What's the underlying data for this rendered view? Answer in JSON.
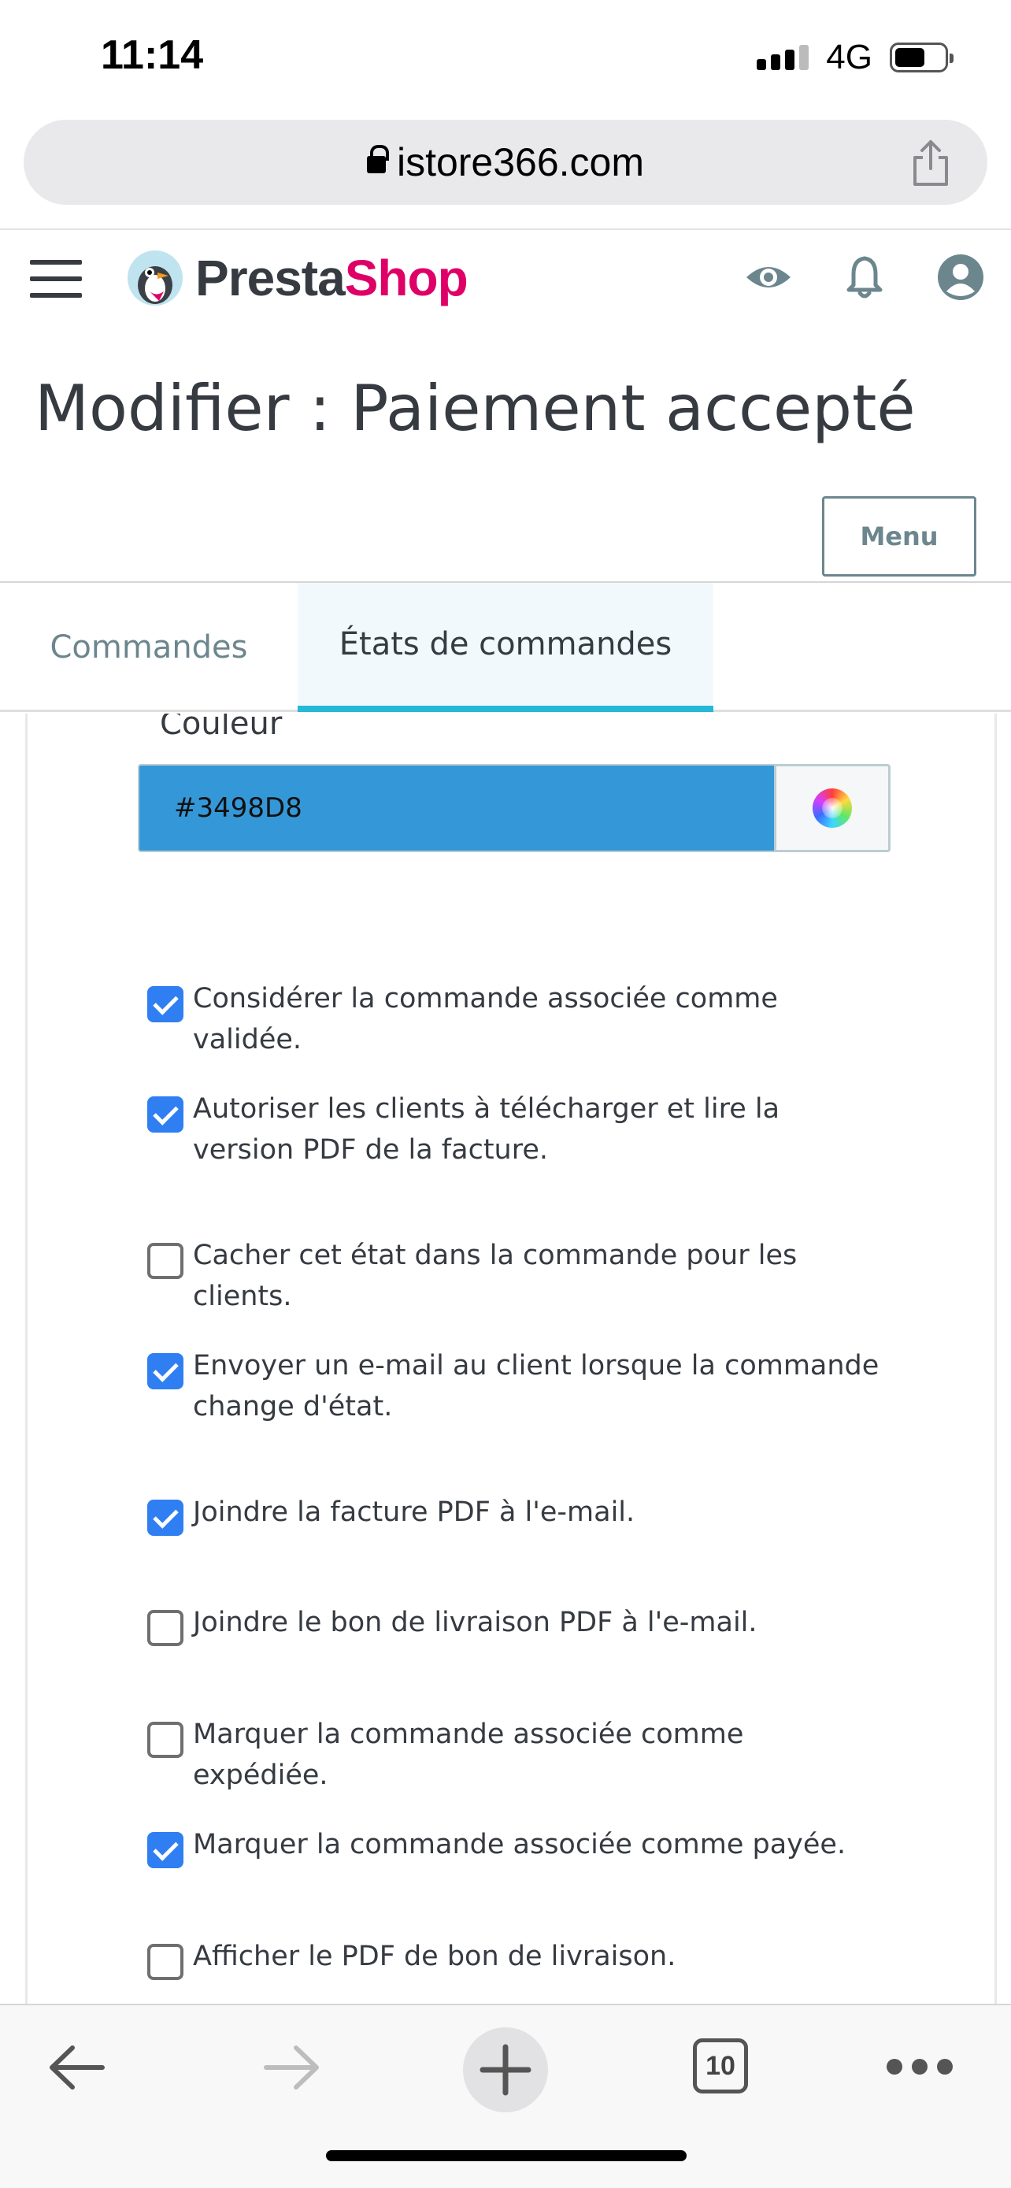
{
  "status_bar": {
    "time": "11:14",
    "network": "4G"
  },
  "browser": {
    "url": "istore366.com",
    "open_tabs": "10"
  },
  "header": {
    "logo_presta": "Presta",
    "logo_shop": "Shop"
  },
  "page": {
    "title": "Modifier : Paiement accepté",
    "menu_button": "Menu"
  },
  "tabs": [
    {
      "label": "Commandes",
      "active": false
    },
    {
      "label": "États de commandes",
      "active": true
    }
  ],
  "form": {
    "color_label": "Couleur",
    "color_value": "#3498D8",
    "options": [
      {
        "label": "Considérer la commande associée comme validée.",
        "checked": true
      },
      {
        "label": "Autoriser les clients à télécharger et lire la version PDF de la facture.",
        "checked": true
      },
      {
        "label": "Cacher cet état dans la commande pour les clients.",
        "checked": false
      },
      {
        "label": "Envoyer un e-mail au client lorsque la commande change d'état.",
        "checked": true
      },
      {
        "label": "Joindre la facture PDF à l'e-mail.",
        "checked": true
      },
      {
        "label": "Joindre le bon de livraison PDF à l'e-mail.",
        "checked": false
      },
      {
        "label": "Marquer la commande associée comme expédiée.",
        "checked": false
      },
      {
        "label": "Marquer la commande associée comme payée.",
        "checked": true
      },
      {
        "label": "Afficher le PDF de bon de livraison.",
        "checked": false
      }
    ]
  },
  "colors": {
    "accent": "#25b9d7",
    "brand_pink": "#df0067",
    "checkbox_blue": "#2f7ff2",
    "color_swatch": "#3498d8"
  }
}
